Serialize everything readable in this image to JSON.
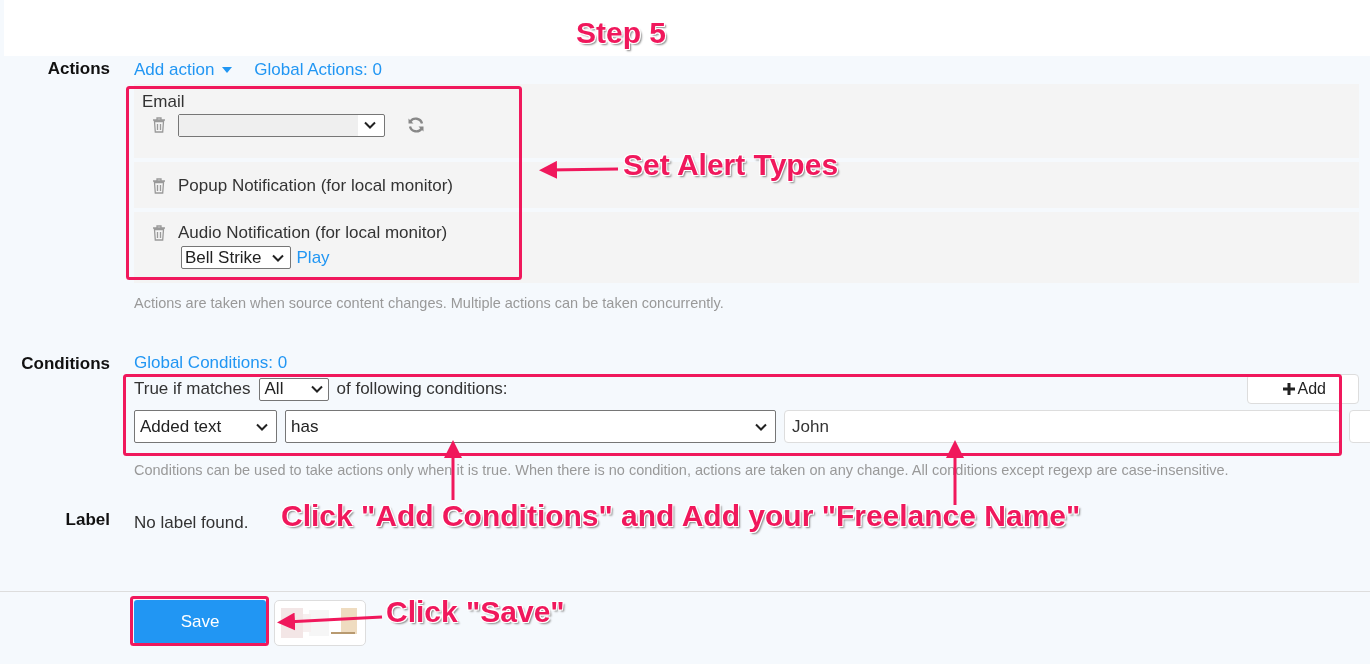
{
  "actions": {
    "label": "Actions",
    "add_action": "Add action",
    "global_actions": "Global Actions: 0",
    "items": [
      {
        "kind": "email",
        "title": "Email"
      },
      {
        "kind": "popup",
        "title": "Popup Notification (for local monitor)"
      },
      {
        "kind": "audio",
        "title": "Audio Notification (for local monitor)",
        "sound": "Bell Strike",
        "play": "Play"
      }
    ],
    "help": "Actions are taken when source content changes. Multiple actions can be taken concurrently."
  },
  "conditions": {
    "label": "Conditions",
    "global_conditions": "Global Conditions: 0",
    "prefix": "True if matches",
    "match": "All",
    "suffix": "of following conditions:",
    "add_button": "Add",
    "rows": [
      {
        "field": "Added text",
        "operator": "has",
        "value": "John"
      }
    ],
    "help": "Conditions can be used to take actions only when it is true. When there is no condition, actions are taken on any change. All conditions except regexp are case-insensitive."
  },
  "label_section": {
    "label": "Label",
    "text": "No label found."
  },
  "save_button": "Save",
  "annotations": [
    {
      "text": "Step 5"
    },
    {
      "text": "Set Alert Types"
    },
    {
      "text": "Click \"Add Conditions\" and Add your \"Freelance Name\""
    },
    {
      "text": "Click \"Save\""
    }
  ]
}
